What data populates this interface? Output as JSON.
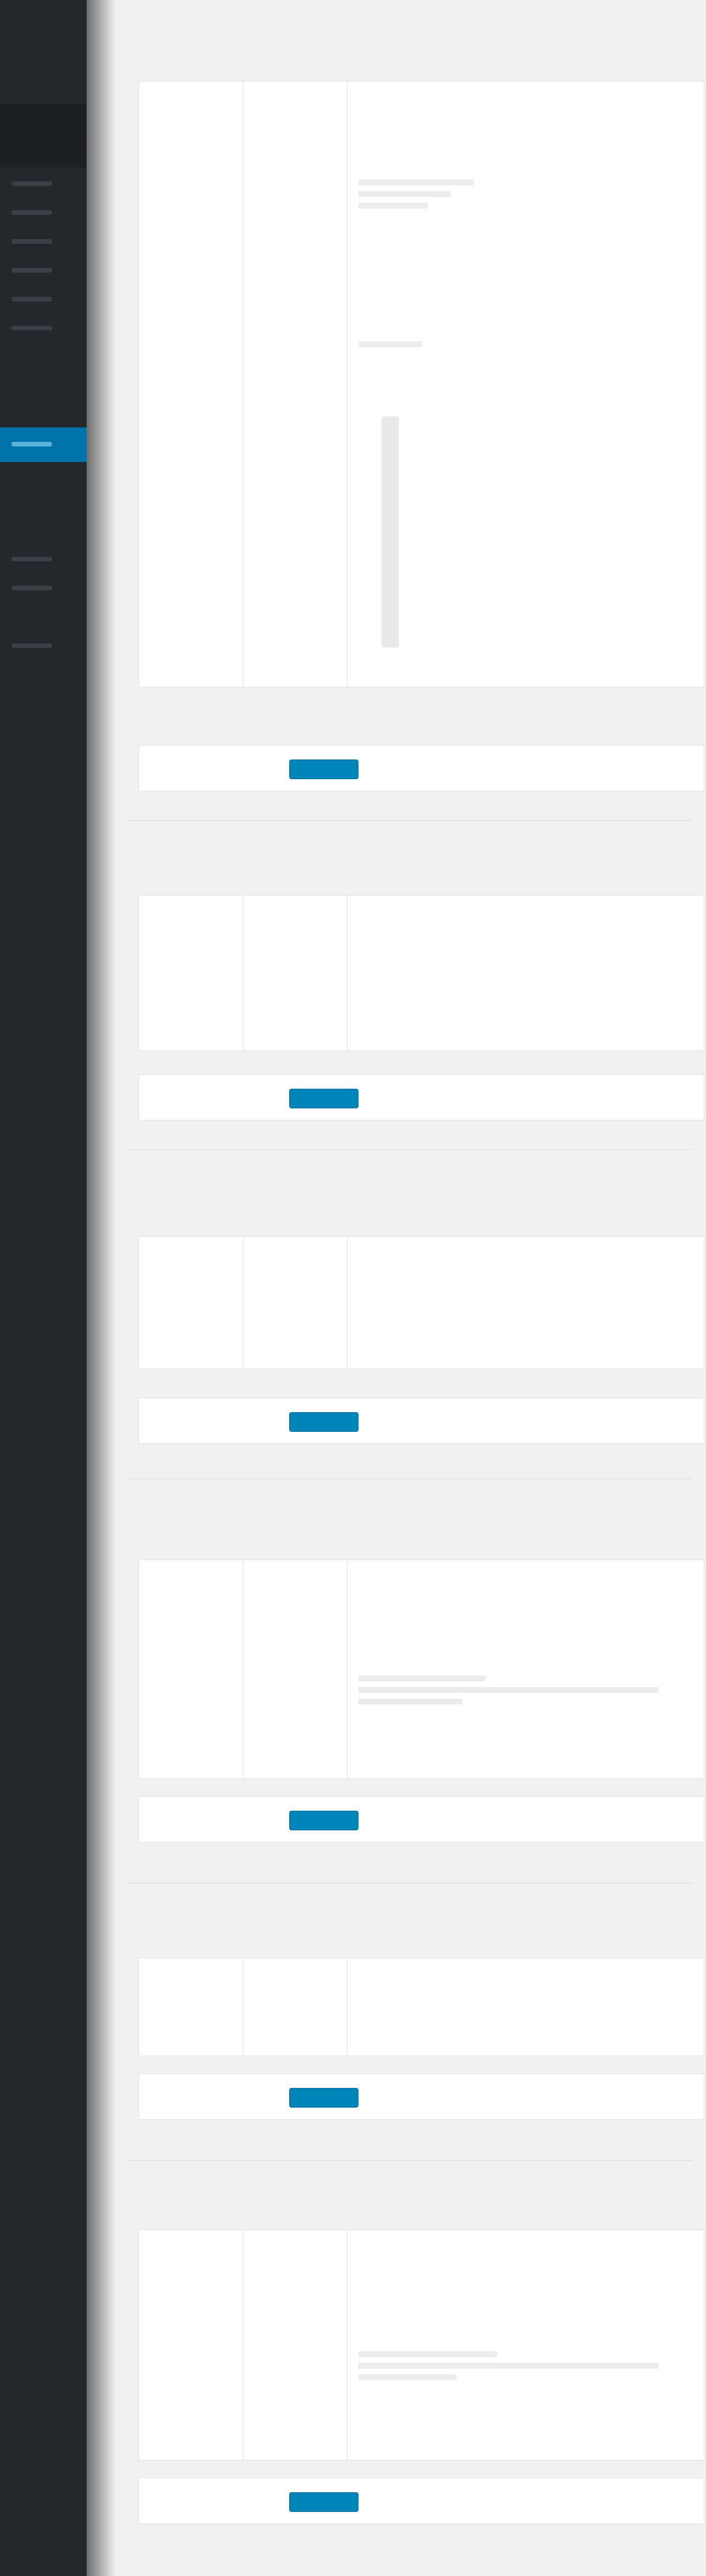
{
  "sidebar": {
    "menu": [
      {
        "label": ""
      },
      {
        "label": ""
      },
      {
        "label": ""
      },
      {
        "label": ""
      },
      {
        "label": ""
      },
      {
        "label": ""
      },
      {
        "label": ""
      },
      {
        "label": ""
      },
      {
        "label": ""
      },
      {
        "label": ""
      }
    ],
    "current_index": 6
  },
  "sections": [
    {
      "caption": "",
      "button_label": "",
      "footer_label": "",
      "variant": "long"
    },
    {
      "caption": "",
      "button_label": "",
      "footer_label": "",
      "variant": "short"
    },
    {
      "caption": "",
      "button_label": "",
      "footer_label": "",
      "variant": "short"
    },
    {
      "caption": "",
      "button_label": "",
      "footer_label": "",
      "variant": "long"
    },
    {
      "caption": "",
      "button_label": "",
      "footer_label": "",
      "variant": "short"
    },
    {
      "caption": "",
      "button_label": "",
      "footer_label": "",
      "variant": "long"
    }
  ],
  "colors": {
    "sidebar": "#23282d",
    "accent": "#0073aa",
    "button": "#0085ba",
    "background": "#f1f1f1"
  }
}
